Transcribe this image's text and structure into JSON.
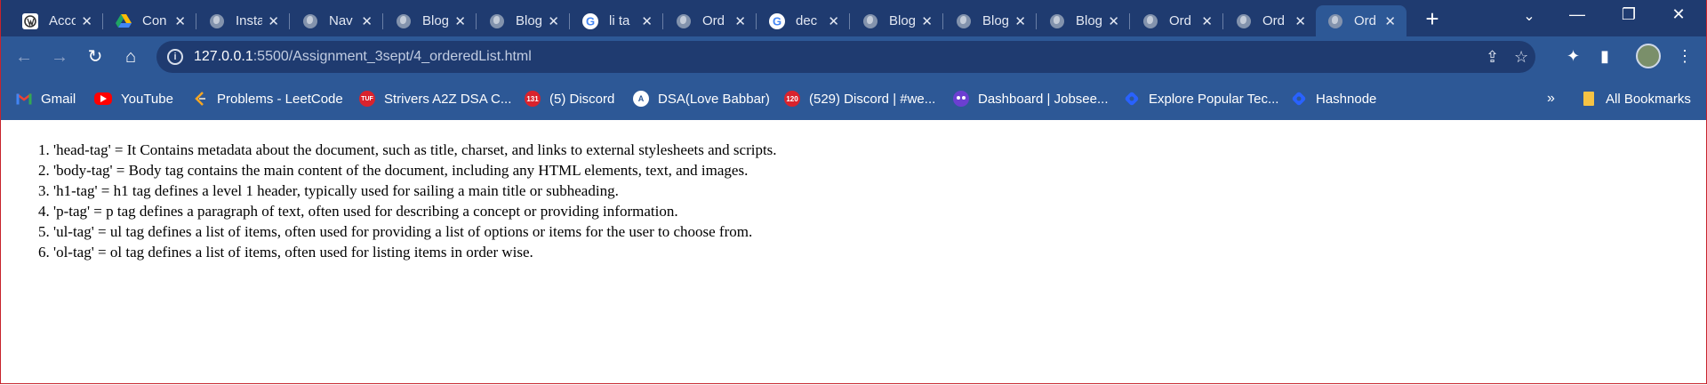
{
  "tabs": [
    {
      "title": "Acco",
      "icon": "wordpress-icon"
    },
    {
      "title": "Con",
      "icon": "google-drive-icon"
    },
    {
      "title": "Insta",
      "icon": "globe-icon"
    },
    {
      "title": "Nav",
      "icon": "globe-icon"
    },
    {
      "title": "Blog",
      "icon": "globe-icon"
    },
    {
      "title": "Blog",
      "icon": "globe-icon"
    },
    {
      "title": "li ta",
      "icon": "google-icon"
    },
    {
      "title": "Ord",
      "icon": "globe-icon"
    },
    {
      "title": "dec",
      "icon": "google-icon"
    },
    {
      "title": "Blog",
      "icon": "globe-icon"
    },
    {
      "title": "Blog",
      "icon": "globe-icon"
    },
    {
      "title": "Blog",
      "icon": "globe-icon"
    },
    {
      "title": "Ord",
      "icon": "globe-icon"
    },
    {
      "title": "Ord",
      "icon": "globe-icon"
    },
    {
      "title": "Ord",
      "icon": "globe-icon",
      "active": true
    }
  ],
  "address_bar": {
    "host": "127.0.0.1",
    "path": ":5500/Assignment_3sept/4_orderedList.html"
  },
  "bookmarks": [
    {
      "label": "Gmail",
      "icon": "gmail-icon"
    },
    {
      "label": "YouTube",
      "icon": "youtube-icon"
    },
    {
      "label": "Problems - LeetCode",
      "icon": "leetcode-icon"
    },
    {
      "label": "Strivers A2Z DSA C...",
      "icon": "tuf-icon",
      "badge": "TUF"
    },
    {
      "label": "(5) Discord",
      "icon": "discord-icon",
      "badge": "131"
    },
    {
      "label": "DSA(Love Babbar)",
      "icon": "dsa-icon"
    },
    {
      "label": "(529) Discord | #we...",
      "icon": "discord-icon",
      "badge": "120"
    },
    {
      "label": "Dashboard | Jobsee...",
      "icon": "jobseeker-icon"
    },
    {
      "label": "Explore Popular Tec...",
      "icon": "hashnode-icon"
    },
    {
      "label": "Hashnode",
      "icon": "hashnode-icon"
    }
  ],
  "all_bookmarks_label": "All Bookmarks",
  "list_items": [
    "'head-tag' = It Contains metadata about the document, such as title, charset, and links to external stylesheets and scripts.",
    "'body-tag' = Body tag contains the main content of the document, including any HTML elements, text, and images.",
    "'h1-tag' = h1 tag defines a level 1 header, typically used for sailing a main title or subheading.",
    "'p-tag' = p tag defines a paragraph of text, often used for describing a concept or providing information.",
    "'ul-tag' = ul tag defines a list of items, often used for providing a list of options or items for the user to choose from.",
    "'ol-tag' = ol tag defines a list of items, often used for listing items in order wise."
  ],
  "colors": {
    "tabstrip": "#1f3b70",
    "toolbar": "#2d5896",
    "window_border": "#c8232c"
  }
}
